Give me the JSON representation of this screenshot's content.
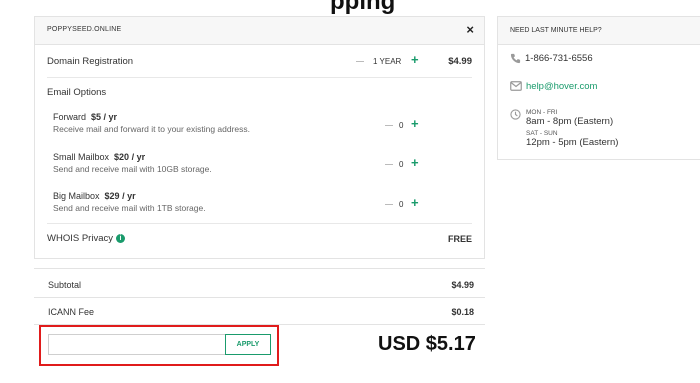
{
  "page": {
    "heading": "pping"
  },
  "cart": {
    "domain_name": "POPPYSEED.ONLINE",
    "close_glyph": "×",
    "registration": {
      "label": "Domain Registration",
      "term": "1 YEAR",
      "price": "$4.99"
    },
    "email_options_label": "Email Options",
    "email_options": [
      {
        "name": "Forward",
        "price": "$5 / yr",
        "description": "Receive mail and forward it to your existing address.",
        "qty": "0"
      },
      {
        "name": "Small Mailbox",
        "price": "$20 / yr",
        "description": "Send and receive mail with 10GB storage.",
        "qty": "0"
      },
      {
        "name": "Big Mailbox",
        "price": "$29 / yr",
        "description": "Send and receive mail with 1TB storage.",
        "qty": "0"
      }
    ],
    "whois": {
      "label": "WHOIS Privacy",
      "info_glyph": "i",
      "price": "FREE"
    }
  },
  "totals": {
    "subtotal_label": "Subtotal",
    "subtotal": "$4.99",
    "icann_label": "ICANN Fee",
    "icann": "$0.18",
    "coupon_placeholder": "",
    "apply_label": "APPLY",
    "grand_total": "USD $5.17"
  },
  "help": {
    "title": "NEED LAST MINUTE HELP?",
    "phone": "1-866-731-6556",
    "email": "help@hover.com",
    "weekday_label": "MON - FRI",
    "weekday_hours": "8am - 8pm (Eastern)",
    "weekend_label": "SAT - SUN",
    "weekend_hours": "12pm - 5pm (Eastern)"
  },
  "colors": {
    "accent": "#1a9b6c",
    "highlight_border": "#e01b1b"
  },
  "icons": [
    "close-icon",
    "plus-icon",
    "minus-icon",
    "info-icon",
    "phone-icon",
    "mail-icon",
    "clock-icon"
  ]
}
